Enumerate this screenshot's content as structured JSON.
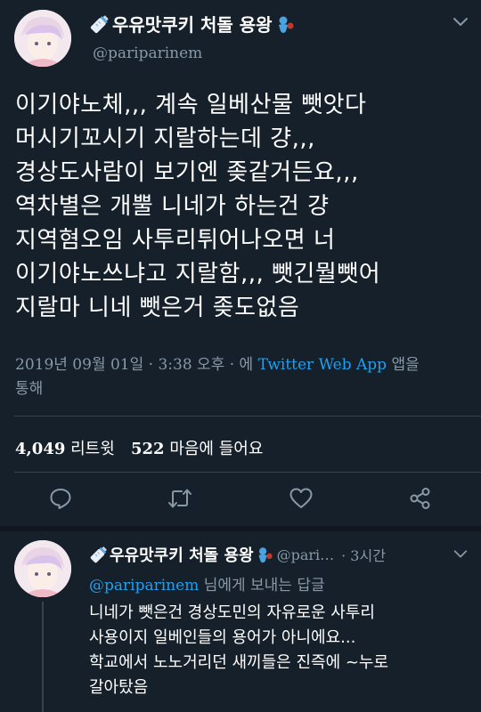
{
  "tweet": {
    "author_name": "우유맛쿠키 처돌 용왕",
    "handle": "@pariparinem",
    "lines": [
      "이기야노체,,, 계속 일베산물 뺏앗다",
      "머시기꼬시기 지랄하는데 걍,,,",
      "경상도사람이 보기엔 좆같거든요,,,",
      "역차별은 개뿔 니네가 하는건 걍",
      "지역혐오임 사투리튀어나오면 너",
      "이기야노쓰냐고 지랄함,,, 뺏긴뭘뺏어",
      "지랄마 니네 뺏은거 좆도없음"
    ],
    "timestamp": "2019년 09월 01일 · 3:38 오후 · 에",
    "source": "Twitter Web App",
    "source_suffix_1": "앱을",
    "source_suffix_2": "통해",
    "retweet_count": "4,049",
    "retweet_label": "리트윗",
    "like_count": "522",
    "like_label": "마음에 들어요"
  },
  "reply": {
    "author_name": "우유맛쿠키 처돌 용왕",
    "handle": "@pari…",
    "time": "· 3시간",
    "reply_to_handle": "@pariparinem",
    "reply_to_suffix": "님에게 보내는 답글",
    "lines": [
      "니네가 뺏은건 경상도민의 자유로운 사투리",
      "사용이지 일베인들의 용어가 아니에요...",
      "학교에서 노노거리던 새끼들은 진즉에 ~누로",
      "갈아탔음"
    ]
  },
  "colors": {
    "background": "#15202b",
    "secondary_text": "#8899a6",
    "link": "#1da1f2",
    "divider": "#38444d"
  }
}
